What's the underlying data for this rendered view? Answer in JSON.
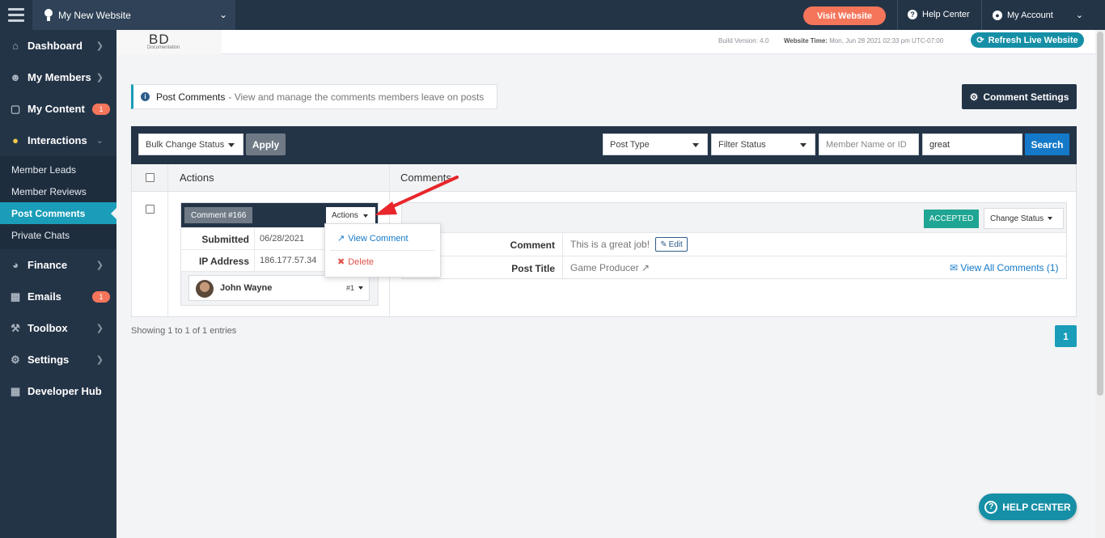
{
  "topbar": {
    "site_name": "My New Website",
    "visit_label": "Visit Website",
    "help_label": "Help Center",
    "account_label": "My Account"
  },
  "sidebar": {
    "items": [
      {
        "label": "Dashboard",
        "icon": "home-icon"
      },
      {
        "label": "My Members",
        "icon": "users-icon"
      },
      {
        "label": "My Content",
        "icon": "folder-icon",
        "badge": "1"
      },
      {
        "label": "Interactions",
        "icon": "comments-icon"
      },
      {
        "label": "Finance",
        "icon": "pie-chart-icon"
      },
      {
        "label": "Emails",
        "icon": "inbox-icon",
        "badge": "1"
      },
      {
        "label": "Toolbox",
        "icon": "wrench-icon"
      },
      {
        "label": "Settings",
        "icon": "gear-icon"
      },
      {
        "label": "Developer Hub",
        "icon": "grid-icon"
      }
    ],
    "interactions_sub": [
      "Member Leads",
      "Member Reviews",
      "Post Comments",
      "Private Chats"
    ]
  },
  "header": {
    "logo_text": "BD",
    "logo_sub": "Documentation",
    "build_version": "Build Version: 4.0",
    "website_time_label": "Website Time:",
    "website_time_value": "Mon, Jun 28 2021 02:33 pm UTC-07:00",
    "refresh_label": "Refresh Live Website"
  },
  "page": {
    "title": "Post Comments",
    "description": "- View and manage the comments members leave on posts",
    "settings_label": "Comment Settings"
  },
  "filters": {
    "bulk_label": "Bulk Change Status",
    "apply_label": "Apply",
    "post_type": "Post Type",
    "filter_status": "Filter Status",
    "member_placeholder": "Member Name or ID",
    "search_value": "great",
    "search_label": "Search"
  },
  "table": {
    "col_actions": "Actions",
    "col_comments": "Comments"
  },
  "comment": {
    "id_label": "Comment #166",
    "actions_label": "Actions",
    "submitted_label": "Submitted",
    "submitted_value": "06/28/2021",
    "ip_label": "IP Address",
    "ip_value": "186.177.57.34",
    "member_name": "John Wayne",
    "member_num": "#1",
    "menu": {
      "view": "View Comment",
      "delete": "Delete"
    },
    "status": "ACCEPTED",
    "change_status": "Change Status",
    "comment_label": "Comment",
    "comment_text": "This is a great job!",
    "edit_label": "Edit",
    "post_title_label": "Post Title",
    "post_title_value": "Game Producer",
    "view_all_label": "View All Comments (1)"
  },
  "footer": {
    "showing": "Showing 1 to 1 of 1 entries",
    "page": "1",
    "help_float": "HELP CENTER"
  },
  "colors": {
    "dark": "#243447",
    "accent": "#1a9db8",
    "orange": "#f5755b",
    "accepted": "#1fa593",
    "annotation": "#e8262b"
  }
}
